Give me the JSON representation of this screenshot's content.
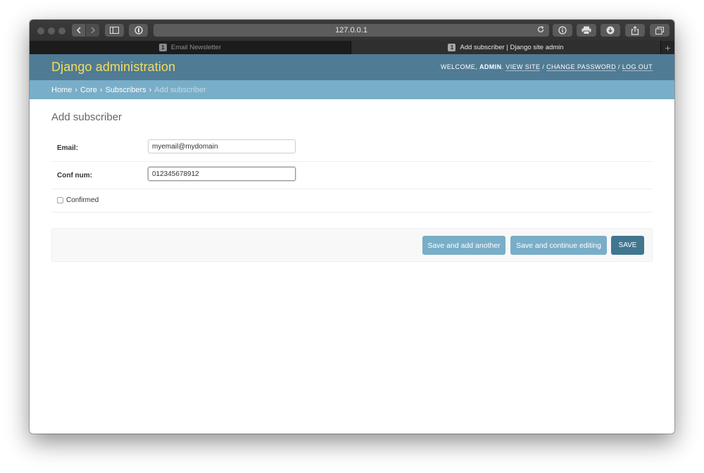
{
  "browser": {
    "url": "127.0.0.1",
    "tabs": [
      {
        "badge": "1",
        "title": "Email Newsletter",
        "active": false
      },
      {
        "badge": "1",
        "title": "Add subscriber | Django site admin",
        "active": true
      }
    ],
    "new_tab_symbol": "+"
  },
  "header": {
    "branding": "Django administration",
    "welcome": "WELCOME,",
    "username": "ADMIN",
    "view_site": "VIEW SITE",
    "change_password": "CHANGE PASSWORD",
    "log_out": "LOG OUT",
    "separator": "/"
  },
  "breadcrumbs": {
    "home": "Home",
    "app": "Core",
    "model": "Subscribers",
    "current": "Add subscriber",
    "separator": "›"
  },
  "page": {
    "title": "Add subscriber"
  },
  "form": {
    "email_label": "Email:",
    "email_value": "myemail@mydomain",
    "conf_num_label": "Conf num:",
    "conf_num_value": "012345678912",
    "confirmed_label": "Confirmed",
    "confirmed_checked": false
  },
  "actions": {
    "save_add_another": "Save and add another",
    "save_continue": "Save and continue editing",
    "save": "SAVE"
  },
  "colors": {
    "header_bg": "#4f7b95",
    "branding": "#f5dd5d",
    "breadcrumbs_bg": "#79aec8",
    "primary_button": "#417690",
    "secondary_button": "#79aec8"
  }
}
